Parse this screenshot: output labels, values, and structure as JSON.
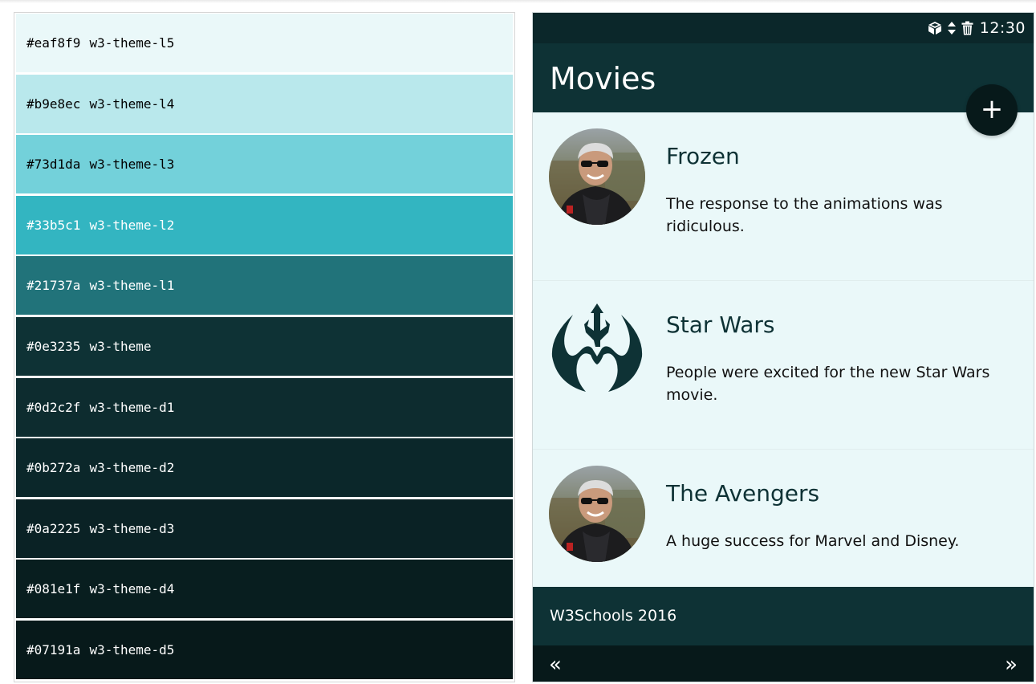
{
  "palette": {
    "swatches": [
      {
        "hex": "#eaf8f9",
        "name": "w3-theme-l5",
        "color": "#eaf8f9",
        "text": "light"
      },
      {
        "hex": "#b9e8ec",
        "name": "w3-theme-l4",
        "color": "#b9e8ec",
        "text": "light"
      },
      {
        "hex": "#73d1da",
        "name": "w3-theme-l3",
        "color": "#73d1da",
        "text": "light"
      },
      {
        "hex": "#33b5c1",
        "name": "w3-theme-l2",
        "color": "#33b5c1",
        "text": "dark"
      },
      {
        "hex": "#21737a",
        "name": "w3-theme-l1",
        "color": "#21737a",
        "text": "dark"
      },
      {
        "hex": "#0e3235",
        "name": "w3-theme",
        "color": "#0e3235",
        "text": "dark"
      },
      {
        "hex": "#0d2c2f",
        "name": "w3-theme-d1",
        "color": "#0d2c2f",
        "text": "dark"
      },
      {
        "hex": "#0b272a",
        "name": "w3-theme-d2",
        "color": "#0b272a",
        "text": "dark"
      },
      {
        "hex": "#0a2225",
        "name": "w3-theme-d3",
        "color": "#0a2225",
        "text": "dark"
      },
      {
        "hex": "#081e1f",
        "name": "w3-theme-d4",
        "color": "#081e1f",
        "text": "dark"
      },
      {
        "hex": "#07191a",
        "name": "w3-theme-d5",
        "color": "#07191a",
        "text": "dark"
      }
    ]
  },
  "phone": {
    "statusbar": {
      "icons": [
        "cube-icon",
        "sort-icon",
        "trash-icon"
      ],
      "time": "12:30"
    },
    "appbar": {
      "title": "Movies",
      "fab_label": "+"
    },
    "items": [
      {
        "title": "Frozen",
        "text": "The response to the animations was ridiculous.",
        "image": "person-avatar"
      },
      {
        "title": "Star Wars",
        "text": "People were excited for the new Star Wars movie.",
        "image": "rebel-alliance-logo"
      },
      {
        "title": "The Avengers",
        "text": "A huge success for Marvel and Disney.",
        "image": "person-avatar"
      }
    ],
    "footer": {
      "text": "W3Schools 2016"
    },
    "nav": {
      "prev": "«",
      "next": "»"
    }
  }
}
